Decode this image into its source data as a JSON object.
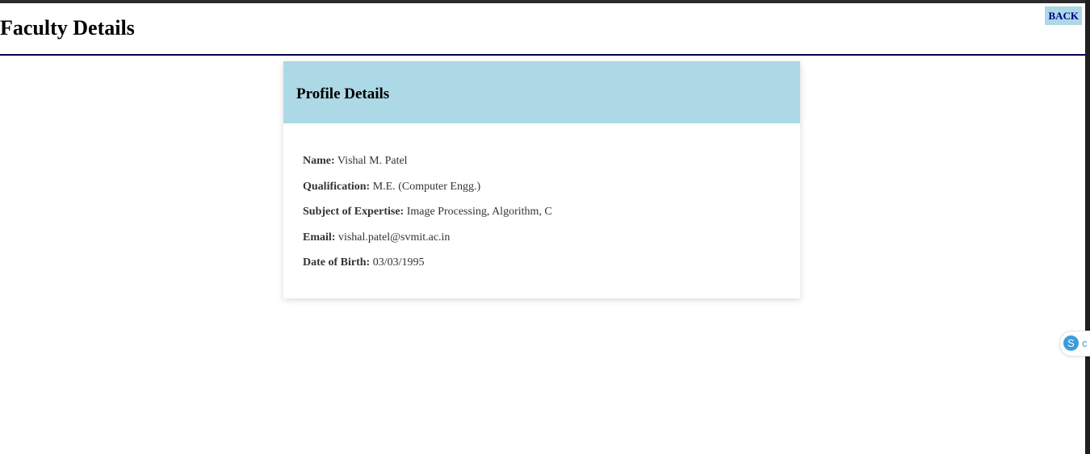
{
  "header": {
    "title": "Faculty Details",
    "back_label": "BACK"
  },
  "card": {
    "title": "Profile Details",
    "fields": [
      {
        "label": "Name:",
        "value": "Vishal M. Patel"
      },
      {
        "label": "Qualification:",
        "value": "M.E. (Computer Engg.)"
      },
      {
        "label": "Subject of Expertise:",
        "value": "Image Processing, Algorithm, C"
      },
      {
        "label": "Email:",
        "value": "vishal.patel@svmit.ac.in"
      },
      {
        "label": "Date of Birth:",
        "value": "03/03/1995"
      }
    ]
  },
  "widget": {
    "icon_letter": "S",
    "label": "c",
    "icon": "skype-icon"
  },
  "colors": {
    "card_header_bg": "#add8e6",
    "back_button_bg": "#add8e6",
    "header_rule": "#00004d",
    "widget_accent": "#3b9cdc"
  }
}
